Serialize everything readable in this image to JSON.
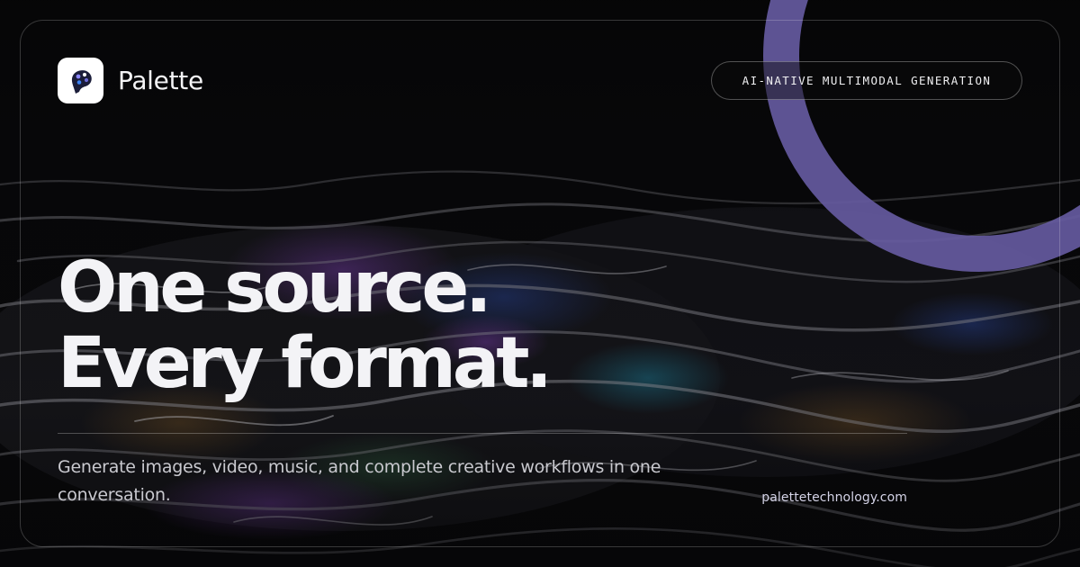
{
  "brand": {
    "name": "Palette",
    "logo_icon": "palette-icon"
  },
  "tagline_pill": "AI-NATIVE MULTIMODAL GENERATION",
  "headline": {
    "line1": "One source.",
    "line2": "Every format."
  },
  "subtitle": "Generate images, video, music, and complete creative workflows in one conversation.",
  "site_url": "palettetechnology.com",
  "colors": {
    "accent_ring": "#655aa0",
    "background": "#060607",
    "text_primary": "#f3f3f6",
    "logo_mark": "#1b1d3a"
  }
}
